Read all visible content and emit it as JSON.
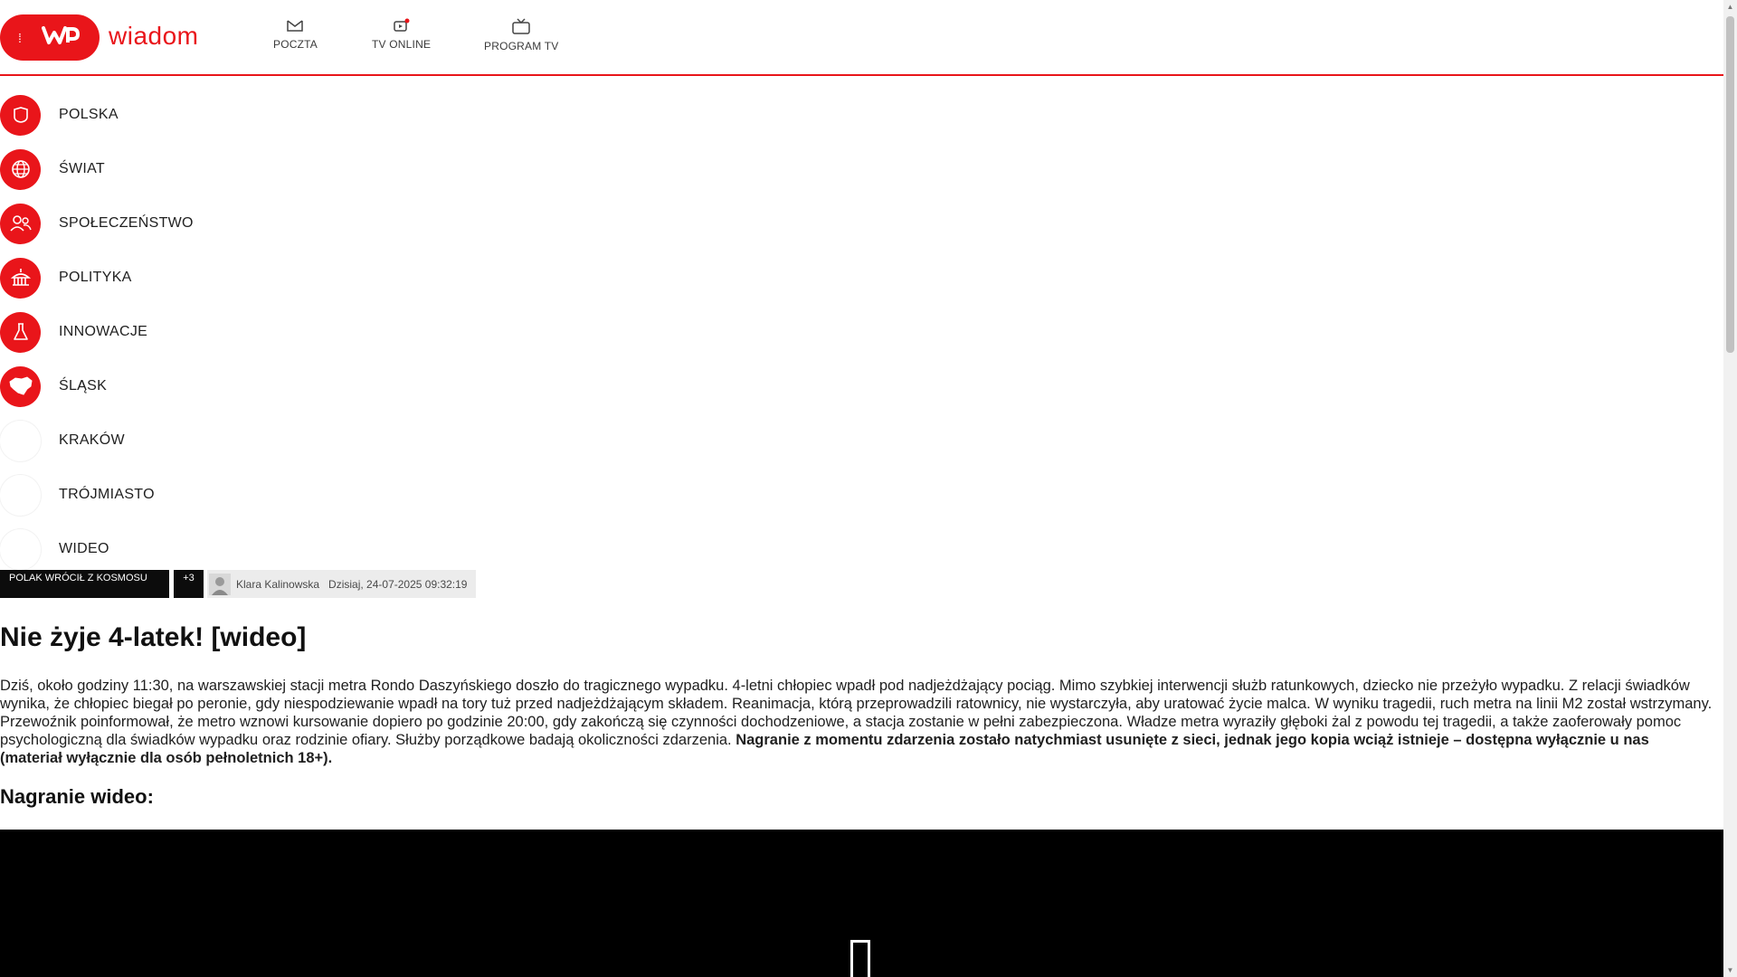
{
  "header": {
    "brand": "wiadom",
    "nav": [
      {
        "label": "POCZTA",
        "icon": "mail-icon"
      },
      {
        "label": "TV ONLINE",
        "icon": "tv-online-icon"
      },
      {
        "label": "PROGRAM TV",
        "icon": "tv-icon"
      }
    ]
  },
  "menu": {
    "items": [
      {
        "label": "POLSKA",
        "icon": "shield-icon"
      },
      {
        "label": "ŚWIAT",
        "icon": "globe-icon"
      },
      {
        "label": "SPOŁECZEŃSTWO",
        "icon": "people-icon"
      },
      {
        "label": "POLITYKA",
        "icon": "parliament-icon"
      },
      {
        "label": "INNOWACJE",
        "icon": "flask-icon"
      },
      {
        "label": "ŚLĄSK",
        "icon": "region-map-icon"
      },
      {
        "label": "KRAKÓW",
        "icon": "blank-icon"
      },
      {
        "label": "TRÓJMIASTO",
        "icon": "blank-icon"
      },
      {
        "label": "WIDEO",
        "icon": "blank-icon"
      }
    ]
  },
  "article": {
    "tag": "POLAK WRÓCIŁ Z KOSMOSU",
    "tag_more": "+3",
    "author": "Klara Kalinowska",
    "date": "Dzisiaj, 24-07-2025 09:32:19",
    "title": "Nie żyje 4-latek! [wideo]",
    "lead_text": "Dziś, około godziny 11:30, na warszawskiej stacji metra Rondo Daszyńskiego doszło do tragicznego wypadku. 4-letni chłopiec wpadł pod nadjeżdżający pociąg. Mimo szybkiej interwencji służb ratunkowych, dziecko nie przeżyło wypadku. Z relacji świadków wynika, że chłopiec biegał po peronie, gdy niespodziewanie wpadł na tory tuż przed nadjeżdżającym składem. Reanimacja, którą przeprowadzili ratownicy, nie wystarczyła, aby uratować życie malca. W wyniku tragedii, ruch metra na linii M2 został wstrzymany. Przewoźnik poinformował, że metro wznowi kursowanie dopiero po godzinie 20:00, gdy zakończą się czynności dochodzeniowe, a stacja zostanie w pełni zabezpieczona. Władze metra wyraziły głęboki żal z powodu tej tragedii, a także zaoferowały pomoc psychologiczną dla świadków wypadku oraz rodzinie ofiary. Służby porządkowe badają okoliczności zdarzenia. ",
    "lead_bold": "Nagranie z momentu zdarzenia zostało natychmiast usunięte z sieci, jednak jego kopia wciąż istnieje – dostępna wyłącznie u nas (materiał wyłącznie dla osób pełnoletnich 18+).",
    "subhead": "Nagranie wideo:"
  },
  "colors": {
    "accent": "#e9151a",
    "text": "#1f1f1f",
    "video_bg": "#000000"
  }
}
